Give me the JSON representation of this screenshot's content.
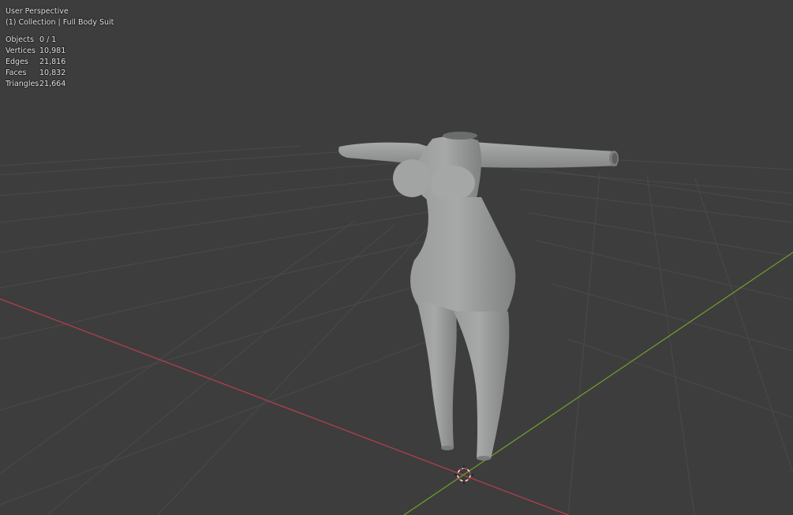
{
  "viewport": {
    "view_name": "User Perspective",
    "collection_label": "(1) Collection | Full Body Suit",
    "stats": [
      {
        "label": "Objects",
        "value": "0 / 1"
      },
      {
        "label": "Vertices",
        "value": "10,981"
      },
      {
        "label": "Edges",
        "value": "21,816"
      },
      {
        "label": "Faces",
        "value": "10,832"
      },
      {
        "label": "Triangles",
        "value": "21,664"
      }
    ]
  },
  "colors": {
    "background": "#3d3d3d",
    "grid": "#4a4a4a",
    "x_axis": "#b0404b",
    "y_axis": "#6e9a2e",
    "mesh": "#9fa1a0",
    "cursor": "#e8e8e8",
    "cursor_accent": "#d23c3c"
  },
  "icons": {
    "cursor": "3d-cursor-icon",
    "mesh": "mesh-object"
  }
}
